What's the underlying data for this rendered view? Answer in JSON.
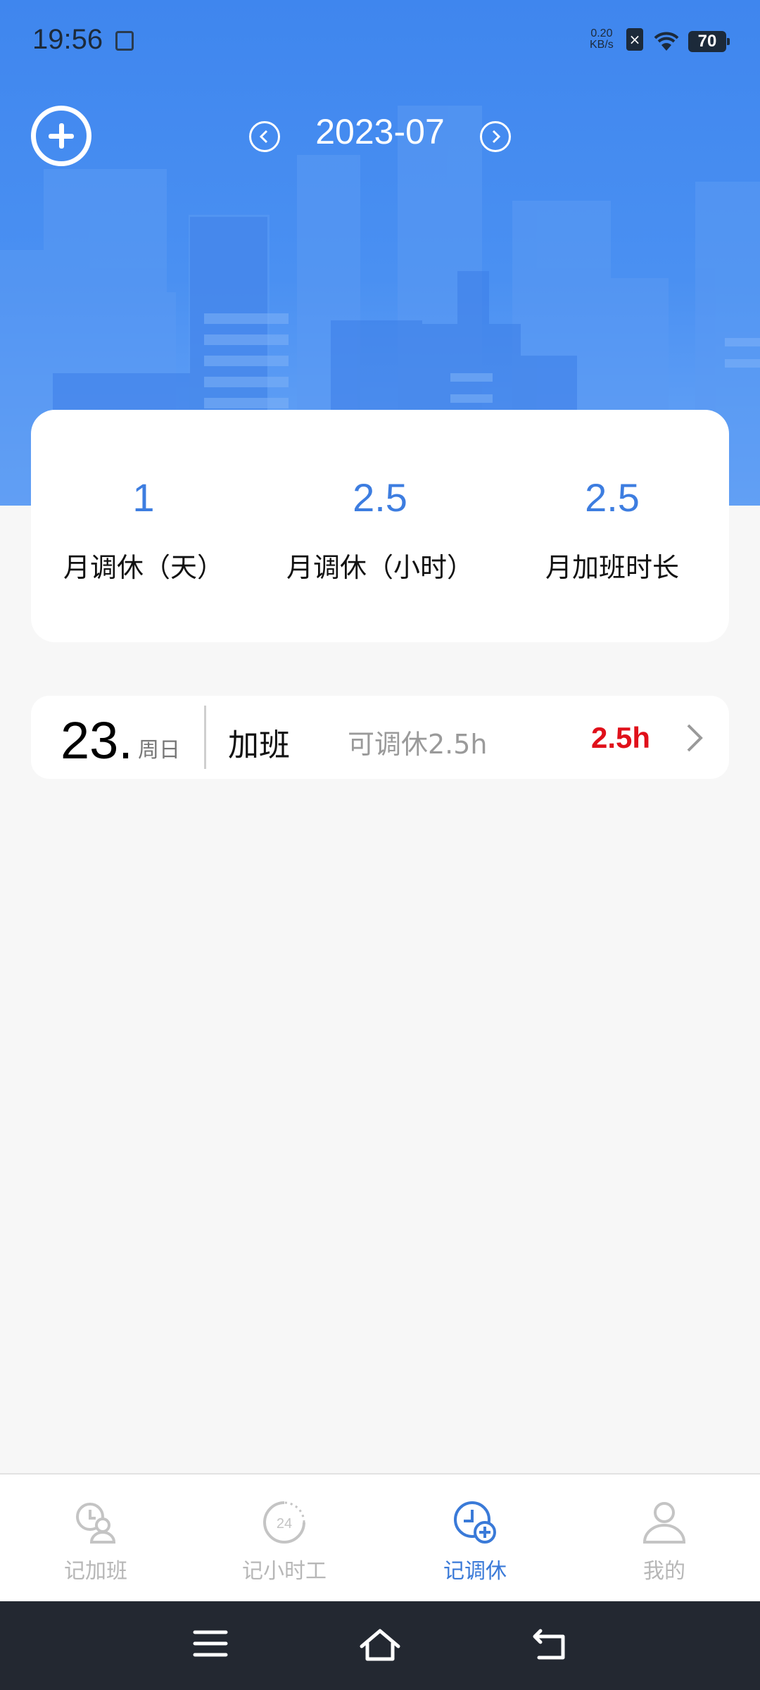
{
  "status_bar": {
    "time": "19:56",
    "net_speed_value": "0.20",
    "net_speed_unit": "KB/s",
    "battery": "70"
  },
  "header": {
    "month": "2023-07",
    "icons": {
      "add": "add-circle-icon",
      "prev": "chevron-left-circle-icon",
      "next": "chevron-right-circle-icon"
    },
    "color": "#4a8cf0"
  },
  "stats": [
    {
      "value": "1",
      "label": "月调休（天）"
    },
    {
      "value": "2.5",
      "label": "月调休（小时）"
    },
    {
      "value": "2.5",
      "label": "月加班时长"
    }
  ],
  "records": [
    {
      "day": "23.",
      "weekday": "周日",
      "type": "加班",
      "note": "可调休2.5h",
      "hours": "2.5h"
    }
  ],
  "tabs": [
    {
      "label": "记加班",
      "icon": "clock-person-icon",
      "active": false
    },
    {
      "label": "记小时工",
      "icon": "24-hours-icon",
      "active": false
    },
    {
      "label": "记调休",
      "icon": "clock-add-icon",
      "active": true
    },
    {
      "label": "我的",
      "icon": "person-icon",
      "active": false
    }
  ],
  "colors": {
    "accent": "#3a7ad8",
    "hours": "#e0101a",
    "inactive": "#b7b7b7"
  }
}
